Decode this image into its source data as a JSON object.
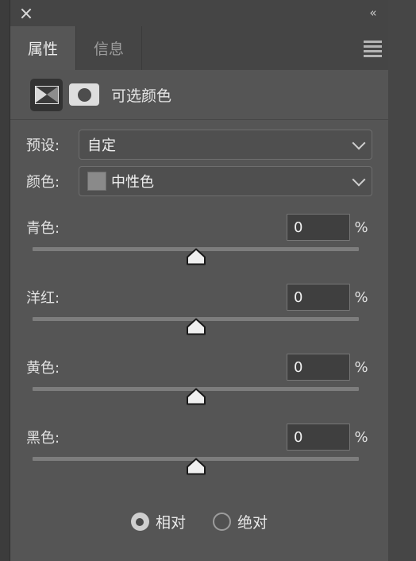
{
  "window": {
    "close_icon": "close-icon",
    "collapse_icon": "«",
    "menu_icon": "panel-menu-icon"
  },
  "tabs": [
    {
      "label": "属性",
      "active": true
    },
    {
      "label": "信息",
      "active": false
    }
  ],
  "adjustment": {
    "layer_icon": "selective-color-icon",
    "mask_icon": "layer-mask-thumbnail",
    "title": "可选颜色"
  },
  "selects": [
    {
      "label": "预设:",
      "value": "自定",
      "has_swatch": false
    },
    {
      "label": "颜色:",
      "value": "中性色",
      "has_swatch": true,
      "swatch_color": "#8a8a8a"
    }
  ],
  "sliders": [
    {
      "label": "青色:",
      "value": "0",
      "unit": "%",
      "position": 50
    },
    {
      "label": "洋红:",
      "value": "0",
      "unit": "%",
      "position": 50
    },
    {
      "label": "黄色:",
      "value": "0",
      "unit": "%",
      "position": 50
    },
    {
      "label": "黑色:",
      "value": "0",
      "unit": "%",
      "position": 50
    }
  ],
  "method": {
    "options": [
      {
        "label": "相对",
        "selected": true
      },
      {
        "label": "绝对",
        "selected": false
      }
    ]
  },
  "colors": {
    "panel_bg": "#555555",
    "header_bg": "#454545",
    "tab_active_bg": "#565656",
    "text": "#e6e6e6",
    "track": "#7d7d7d",
    "input_bg": "#3f3f3f"
  }
}
